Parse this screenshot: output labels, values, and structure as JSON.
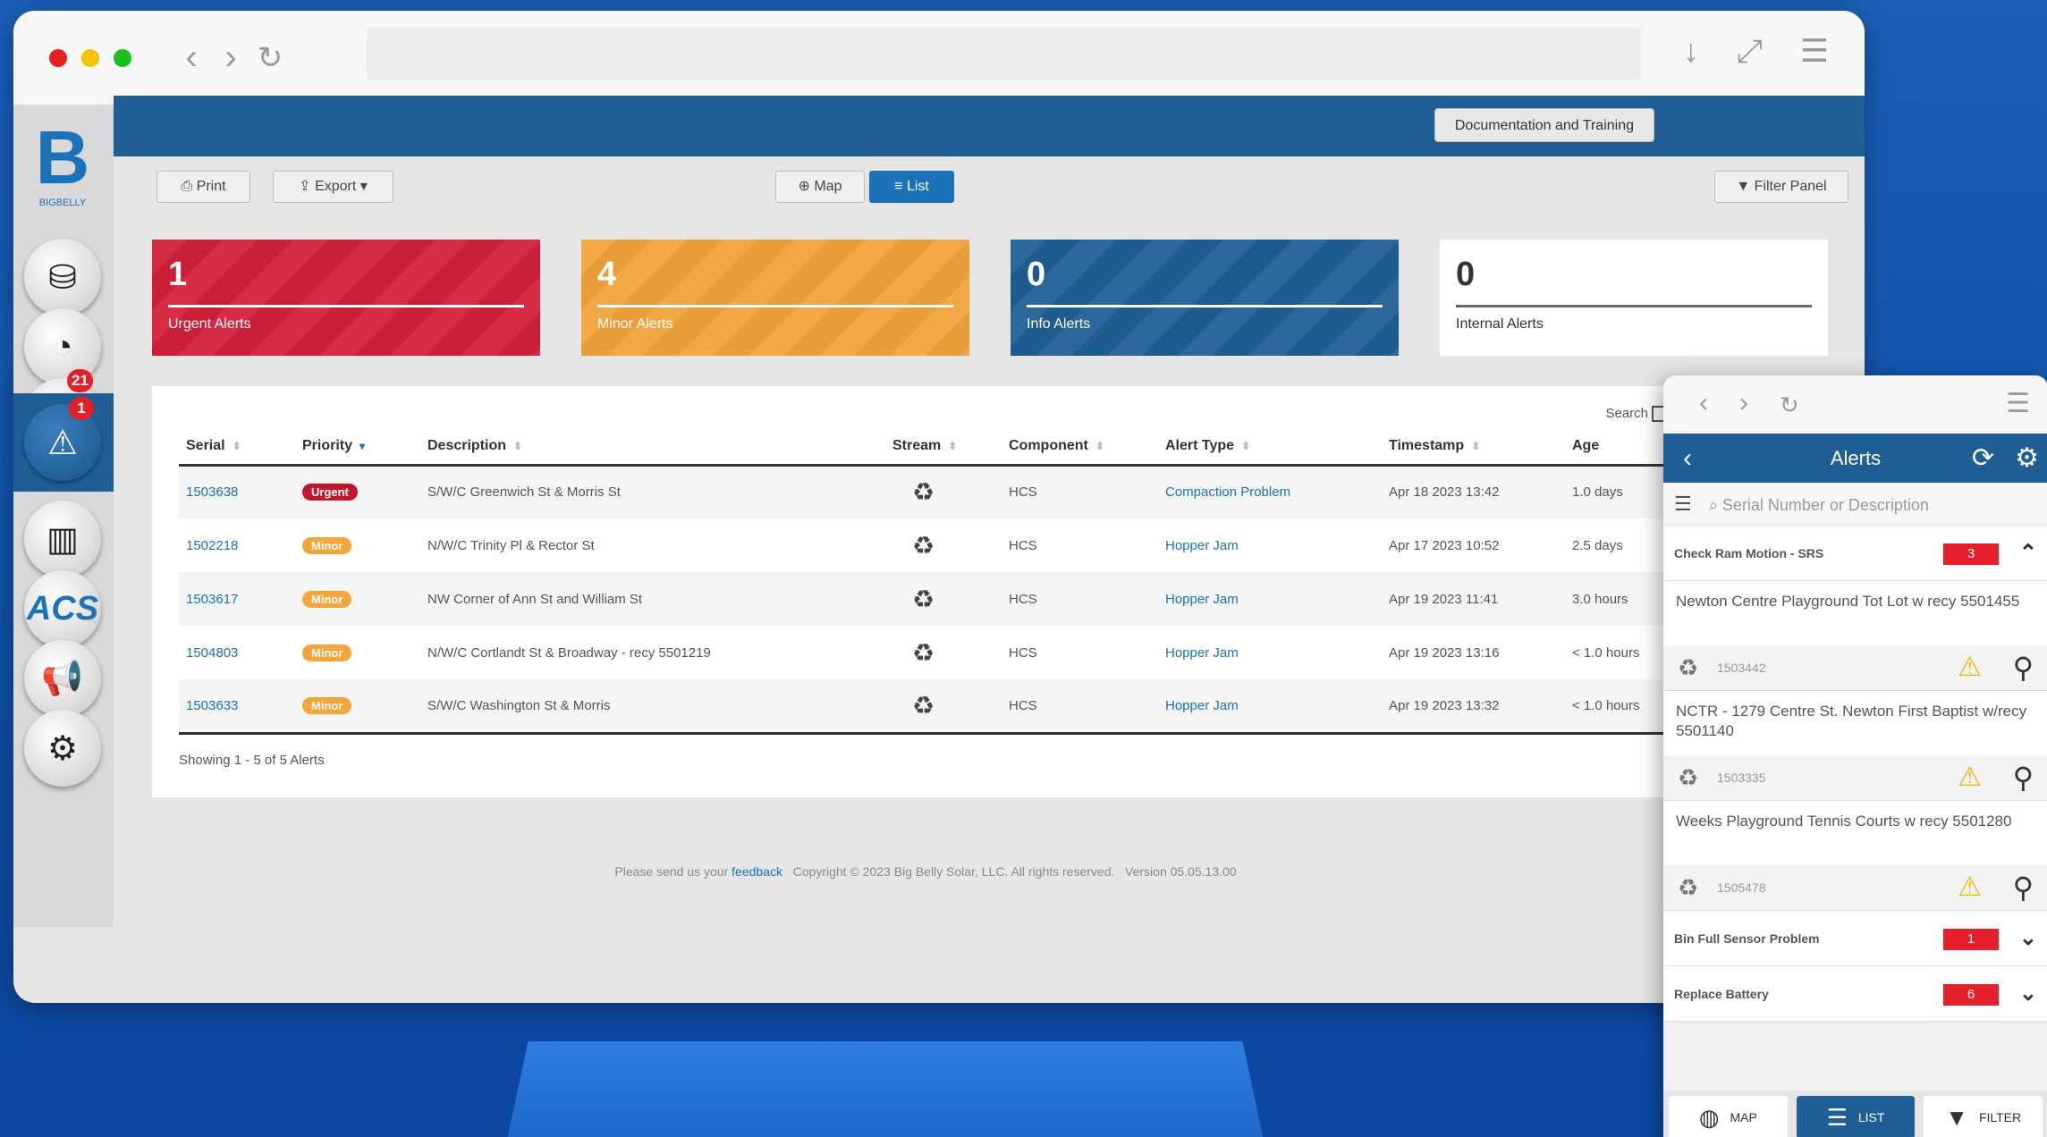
{
  "browser": {
    "header_button": "Documentation and Training",
    "toolbar": {
      "print": "Print",
      "export": "Export",
      "map": "Map",
      "list": "List",
      "filter_panel": "Filter Panel"
    },
    "sidebar": {
      "logo_text": "BIGBELLY",
      "badge_notifications": "21",
      "badge_alerts": "1",
      "acs_label": "ACS"
    },
    "cards": [
      {
        "count": "1",
        "label": "Urgent Alerts",
        "color": "#d31f3a"
      },
      {
        "count": "4",
        "label": "Minor Alerts",
        "color": "#f2a33a"
      },
      {
        "count": "0",
        "label": "Info Alerts",
        "color": "#1f5f95"
      },
      {
        "count": "0",
        "label": "Internal Alerts",
        "color": "#ffffff"
      }
    ],
    "search_label": "Search",
    "table": {
      "headers": [
        "Serial",
        "Priority",
        "Description",
        "Stream",
        "Component",
        "Alert Type",
        "Timestamp",
        "Age"
      ],
      "rows": [
        {
          "serial": "1503638",
          "priority": "Urgent",
          "description": "S/W/C Greenwich St & Morris St",
          "component": "HCS",
          "alert_type": "Compaction Problem",
          "timestamp": "Apr 18 2023 13:42",
          "age": "1.0 days"
        },
        {
          "serial": "1502218",
          "priority": "Minor",
          "description": "N/W/C Trinity Pl & Rector St",
          "component": "HCS",
          "alert_type": "Hopper Jam",
          "timestamp": "Apr 17 2023 10:52",
          "age": "2.5 days"
        },
        {
          "serial": "1503617",
          "priority": "Minor",
          "description": "NW Corner of Ann St and William St",
          "component": "HCS",
          "alert_type": "Hopper Jam",
          "timestamp": "Apr 19 2023 11:41",
          "age": "3.0 hours"
        },
        {
          "serial": "1504803",
          "priority": "Minor",
          "description": "N/W/C Cortlandt St & Broadway - recy 5501219",
          "component": "HCS",
          "alert_type": "Hopper Jam",
          "timestamp": "Apr 19 2023 13:16",
          "age": "< 1.0 hours"
        },
        {
          "serial": "1503633",
          "priority": "Minor",
          "description": "S/W/C Washington St & Morris",
          "component": "HCS",
          "alert_type": "Hopper Jam",
          "timestamp": "Apr 19 2023 13:32",
          "age": "< 1.0 hours"
        }
      ]
    },
    "showing": "Showing 1 - 5 of 5 Alerts",
    "footer": {
      "prefix": "Please send us your",
      "link": "feedback",
      "copyright": "Copyright © 2023 Big Belly Solar, LLC. All rights reserved.",
      "version": "Version 05.05.13.00"
    }
  },
  "mobile": {
    "title": "Alerts",
    "search_placeholder": "Serial Number or Description",
    "groups": [
      {
        "label": "Check Ram Motion - SRS",
        "count": "3",
        "expanded": true
      },
      {
        "label": "Bin Full Sensor Problem",
        "count": "1",
        "expanded": false
      },
      {
        "label": "Replace Battery",
        "count": "6",
        "expanded": false
      }
    ],
    "items": [
      {
        "title": "Newton Centre Playground Tot Lot w recy 5501455",
        "serial": "1503442"
      },
      {
        "title": "NCTR - 1279 Centre St. Newton First Baptist w/recy 5501140",
        "serial": "1503335"
      },
      {
        "title": "Weeks Playground Tennis Courts w recy 5501280",
        "serial": "1505478"
      }
    ],
    "tabs": {
      "map": "MAP",
      "list": "LIST",
      "filter": "FILTER"
    }
  },
  "colors": {
    "header_blue": "#1f5f95",
    "link_blue": "#1a72b8",
    "urgent_red": "#c0182b",
    "minor_orange": "#f5a53a"
  }
}
